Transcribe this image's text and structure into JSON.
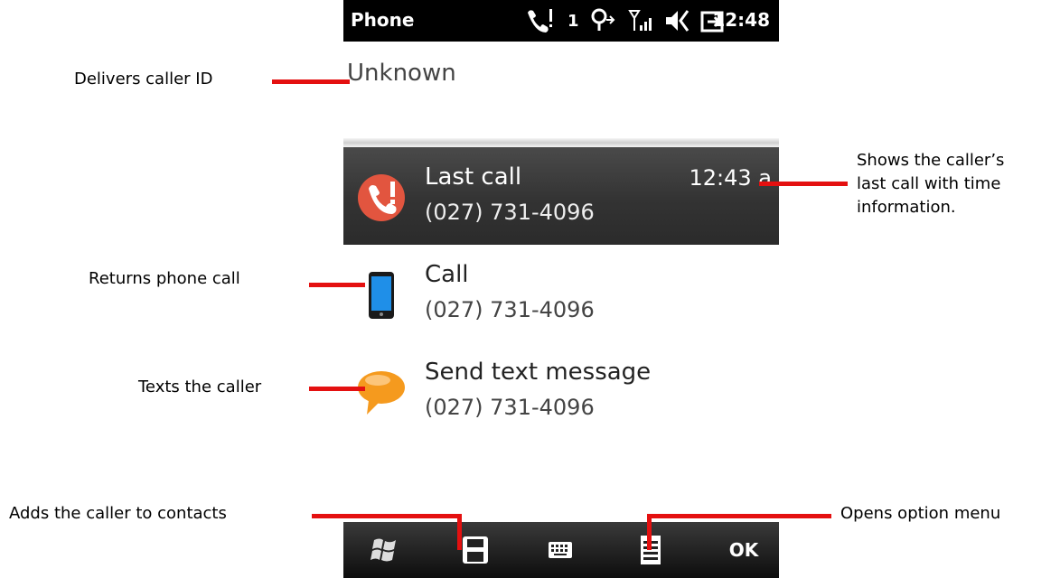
{
  "status_bar": {
    "title": "Phone",
    "time": "12:48",
    "line_indicator": "1",
    "icons": [
      "missed-call-icon",
      "roaming-icon",
      "signal-icon",
      "speaker-muted-icon",
      "power-icon"
    ]
  },
  "caller_id": "Unknown",
  "items": [
    {
      "title": "Last call",
      "number": "(027) 731-4096",
      "time": "12:43 a",
      "icon": "missed-call-icon"
    },
    {
      "title": "Call",
      "number": "(027) 731-4096",
      "icon": "phone-icon"
    },
    {
      "title": "Send text message",
      "number": "(027) 731-4096",
      "icon": "speech-bubble-icon"
    }
  ],
  "bottom_bar": {
    "ok_label": "OK",
    "keys": [
      "start-icon",
      "save-icon",
      "keyboard-icon",
      "menu-icon"
    ]
  },
  "annotations": {
    "caller_id": "Delivers caller ID",
    "last_call": [
      "Shows the caller’s",
      "last call with time",
      "information."
    ],
    "call": "Returns phone call",
    "text": "Texts the caller",
    "contacts": "Adds the caller to contacts",
    "menu": "Opens option menu"
  },
  "colors": {
    "annotation_line": "#e41010",
    "selection": "#333333",
    "background": "#ffffff"
  }
}
